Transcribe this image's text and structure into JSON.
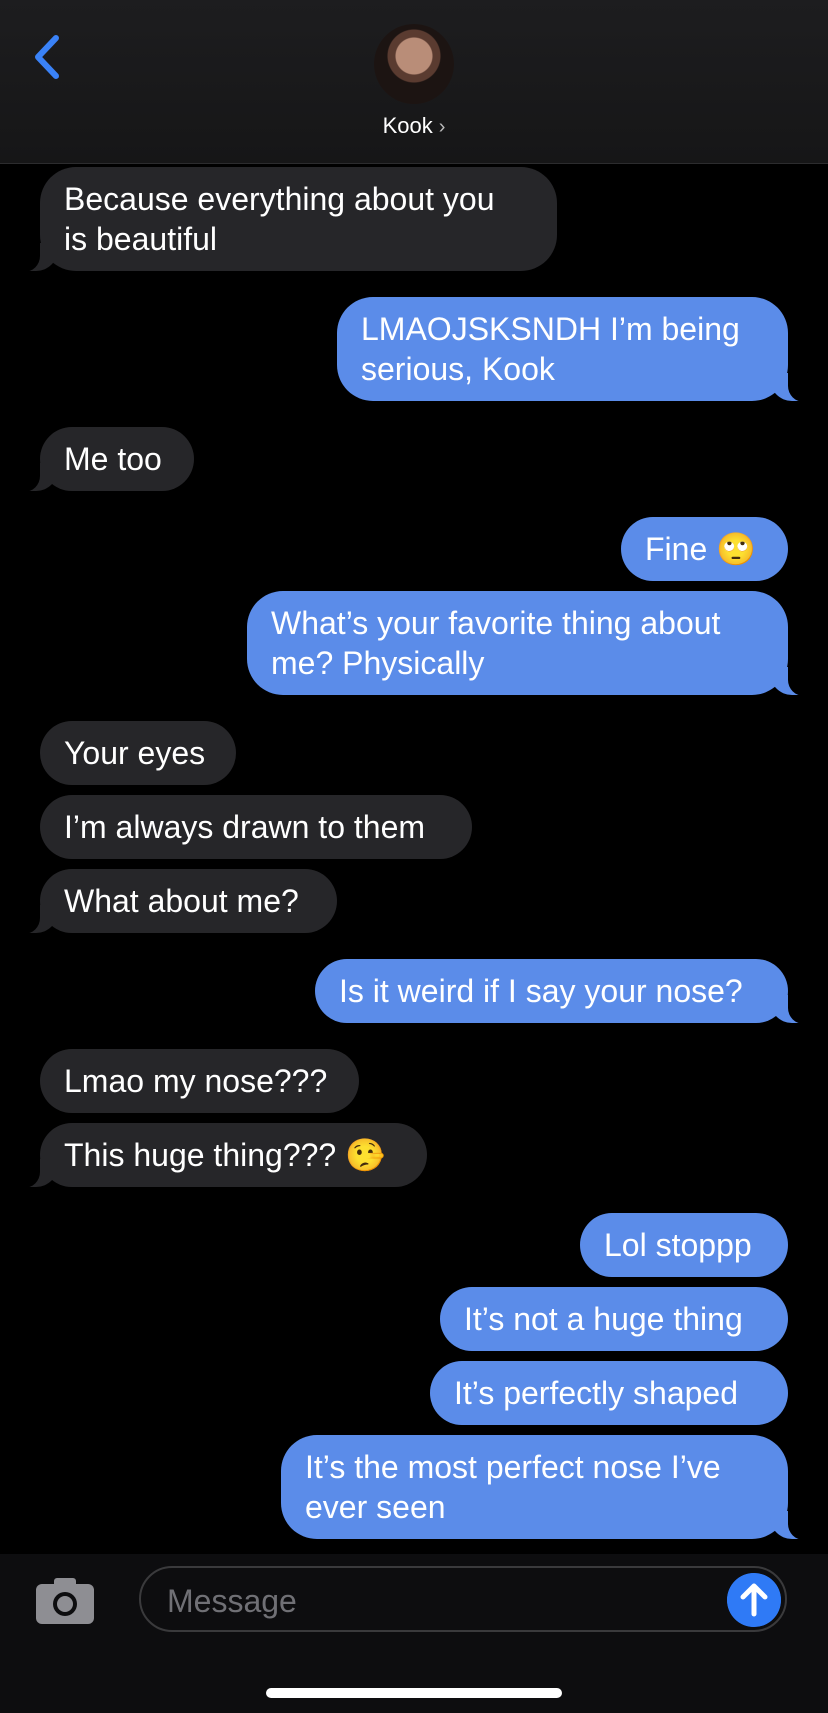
{
  "header": {
    "contact_name": "Kook",
    "chevron": "›"
  },
  "messages": [
    {
      "from": "them",
      "text": "Because everything about you\nis beautiful"
    },
    {
      "from": "me",
      "text": "LMAOJSKSNDH I’m being\nserious, Kook"
    },
    {
      "from": "them",
      "text": "Me too"
    },
    {
      "from": "me",
      "text": "Fine 🙄"
    },
    {
      "from": "me",
      "text": "What’s your favorite thing about\nme? Physically"
    },
    {
      "from": "them",
      "text": "Your eyes"
    },
    {
      "from": "them",
      "text": "I’m always drawn to them"
    },
    {
      "from": "them",
      "text": "What about me?"
    },
    {
      "from": "me",
      "text": "Is it weird if I say your nose?"
    },
    {
      "from": "them",
      "text": "Lmao my nose???"
    },
    {
      "from": "them",
      "text": "This huge thing??? 🤥"
    },
    {
      "from": "me",
      "text": "Lol stoppp"
    },
    {
      "from": "me",
      "text": "It’s not a huge thing"
    },
    {
      "from": "me",
      "text": "It’s perfectly shaped"
    },
    {
      "from": "me",
      "text": "It’s the most perfect nose I’ve\never seen"
    }
  ],
  "composer": {
    "placeholder": "Message"
  },
  "icons": {
    "back": "chevron-left-icon",
    "camera": "camera-icon",
    "send": "arrow-up-icon"
  },
  "colors": {
    "outgoing_bubble": "#5b8ce9",
    "incoming_bubble": "#262629",
    "accent": "#2f7af6"
  }
}
